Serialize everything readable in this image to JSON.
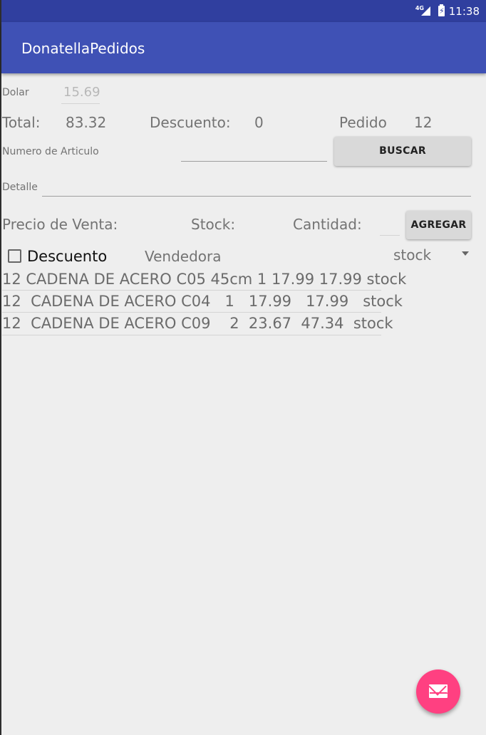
{
  "status_bar": {
    "network": "4G",
    "time": "11:38",
    "icons": [
      "signal-icon",
      "battery-charging-icon"
    ]
  },
  "app_title": "DonatellaPedidos",
  "dolar": {
    "label": "Dolar",
    "value": "15.69"
  },
  "totals": {
    "total_label": "Total:",
    "total_value": "83.32",
    "descuento_label": "Descuento:",
    "descuento_value": "0",
    "pedido_label": "Pedido",
    "pedido_value": "12"
  },
  "search": {
    "label": "Numero de Articulo",
    "value": "",
    "button": "BUSCAR"
  },
  "detalle": {
    "label": "Detalle",
    "value": ""
  },
  "sale": {
    "precio_label": "Precio de Venta:",
    "stock_label": "Stock:",
    "cantidad_label": "Cantidad:",
    "cantidad_value": "",
    "button": "AGREGAR"
  },
  "options": {
    "descuento_label": "Descuento",
    "descuento_checked": false,
    "vendedora_label": "Vendedora",
    "dropdown_value": "stock"
  },
  "rows": [
    {
      "text": "12 CADENA DE ACERO C05 45cm 1 17.99 17.99 stock"
    },
    {
      "text": "12  CADENA DE ACERO C04   1   17.99   17.99   stock"
    },
    {
      "text": "12  CADENA DE ACERO C09    2  23.67  47.34  stock"
    }
  ],
  "fab": {
    "icon": "mail-icon"
  },
  "colors": {
    "primary": "#3f51b5",
    "primary_dark": "#303f9f",
    "accent": "#ff4081",
    "background": "#eeeeee"
  }
}
